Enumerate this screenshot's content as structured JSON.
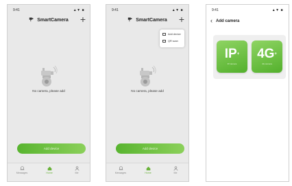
{
  "phones": [
    {
      "status": {
        "time": "9:41",
        "signal": "▲▼ ■"
      },
      "nav": {
        "brand": "SmartCamera",
        "plus": "+"
      },
      "empty_text": "No camera, please add",
      "add_button": "Add device",
      "tabs": [
        {
          "label": "Messages"
        },
        {
          "label": "Home"
        },
        {
          "label": "Me"
        }
      ]
    },
    {
      "status": {
        "time": "9:41",
        "signal": "▲▼ ■"
      },
      "nav": {
        "brand": "SmartCamera",
        "plus": "+"
      },
      "dropdown": [
        {
          "label": "Add device"
        },
        {
          "label": "QR scan"
        }
      ],
      "empty_text": "No camera, please add",
      "add_button": "Add device",
      "tabs": [
        {
          "label": "Messages"
        },
        {
          "label": "Home"
        },
        {
          "label": "Me"
        }
      ]
    },
    {
      "status": {
        "time": "9:41",
        "signal": "▲▼ ■"
      },
      "nav": {
        "back": "‹",
        "title": "Add camera"
      },
      "camera_types": [
        {
          "label": "IP",
          "sup": "+",
          "caption": "IP camera"
        },
        {
          "label": "4G",
          "sup": "+",
          "caption": "4G camera"
        }
      ]
    }
  ],
  "colors": {
    "accent": "#6ab33a",
    "button_start": "#58b42f",
    "button_end": "#8bd05a"
  }
}
